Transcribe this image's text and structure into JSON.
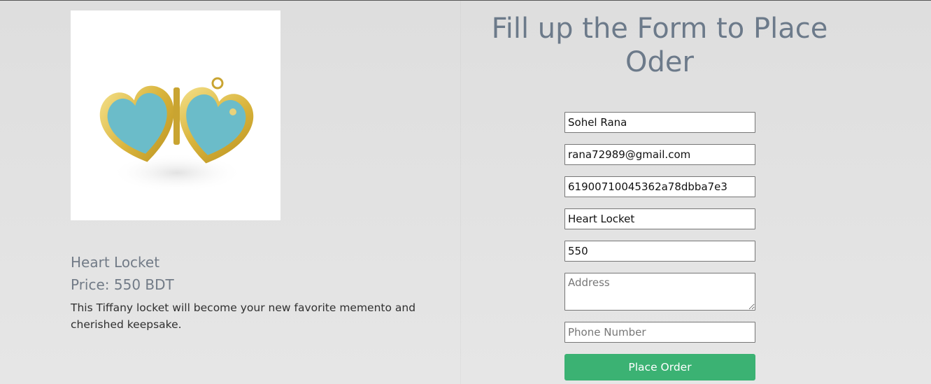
{
  "product": {
    "image_alt": "heart-locket-image",
    "name": "Heart Locket",
    "price": "Price: 550 BDT",
    "description": "This Tiffany locket will become your new favorite memento and cherished keepsake."
  },
  "form": {
    "title": "Fill up the Form to Place Oder",
    "fields": {
      "name": {
        "value": "Sohel Rana",
        "placeholder": ""
      },
      "email": {
        "value": "rana72989@gmail.com",
        "placeholder": ""
      },
      "product_id": {
        "value": "61900710045362a78dbba7e3",
        "placeholder": ""
      },
      "product_name": {
        "value": "Heart Locket",
        "placeholder": ""
      },
      "price": {
        "value": "550",
        "placeholder": ""
      },
      "address": {
        "value": "",
        "placeholder": "Address"
      },
      "phone": {
        "value": "",
        "placeholder": "Phone Number"
      }
    },
    "submit_label": "Place Order"
  },
  "colors": {
    "accent": "#3bb273",
    "title_gray": "#6c7a8a",
    "background": "#e3e3e3"
  }
}
